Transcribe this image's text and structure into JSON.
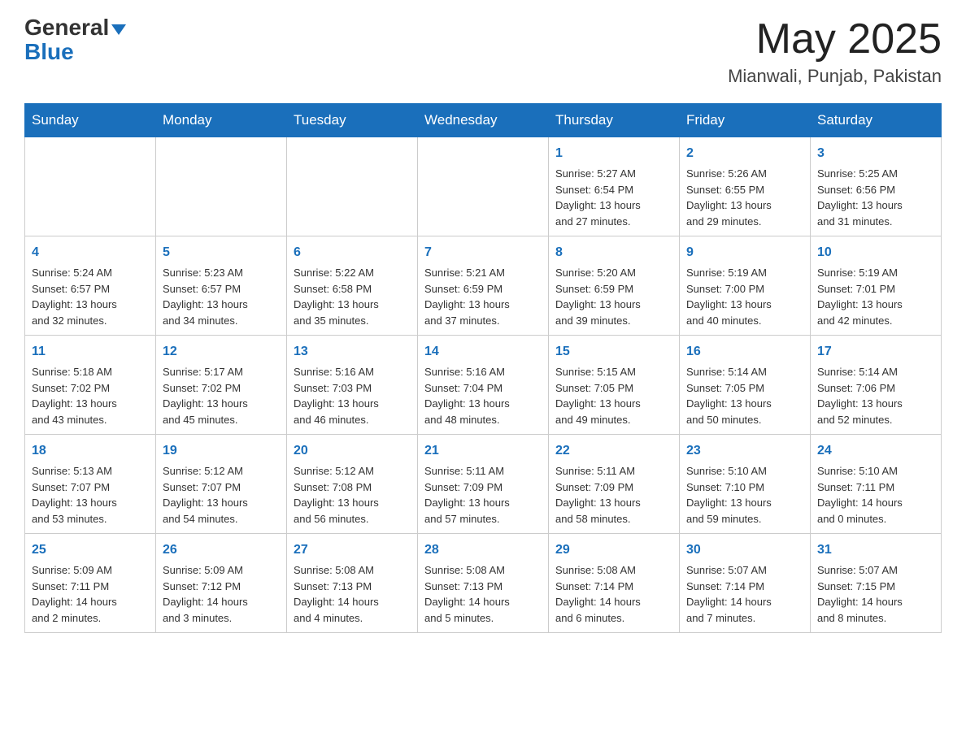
{
  "header": {
    "logo_general": "General",
    "logo_blue": "Blue",
    "month_title": "May 2025",
    "location": "Mianwali, Punjab, Pakistan"
  },
  "weekdays": [
    "Sunday",
    "Monday",
    "Tuesday",
    "Wednesday",
    "Thursday",
    "Friday",
    "Saturday"
  ],
  "weeks": [
    {
      "days": [
        {
          "number": "",
          "info": ""
        },
        {
          "number": "",
          "info": ""
        },
        {
          "number": "",
          "info": ""
        },
        {
          "number": "",
          "info": ""
        },
        {
          "number": "1",
          "info": "Sunrise: 5:27 AM\nSunset: 6:54 PM\nDaylight: 13 hours\nand 27 minutes."
        },
        {
          "number": "2",
          "info": "Sunrise: 5:26 AM\nSunset: 6:55 PM\nDaylight: 13 hours\nand 29 minutes."
        },
        {
          "number": "3",
          "info": "Sunrise: 5:25 AM\nSunset: 6:56 PM\nDaylight: 13 hours\nand 31 minutes."
        }
      ]
    },
    {
      "days": [
        {
          "number": "4",
          "info": "Sunrise: 5:24 AM\nSunset: 6:57 PM\nDaylight: 13 hours\nand 32 minutes."
        },
        {
          "number": "5",
          "info": "Sunrise: 5:23 AM\nSunset: 6:57 PM\nDaylight: 13 hours\nand 34 minutes."
        },
        {
          "number": "6",
          "info": "Sunrise: 5:22 AM\nSunset: 6:58 PM\nDaylight: 13 hours\nand 35 minutes."
        },
        {
          "number": "7",
          "info": "Sunrise: 5:21 AM\nSunset: 6:59 PM\nDaylight: 13 hours\nand 37 minutes."
        },
        {
          "number": "8",
          "info": "Sunrise: 5:20 AM\nSunset: 6:59 PM\nDaylight: 13 hours\nand 39 minutes."
        },
        {
          "number": "9",
          "info": "Sunrise: 5:19 AM\nSunset: 7:00 PM\nDaylight: 13 hours\nand 40 minutes."
        },
        {
          "number": "10",
          "info": "Sunrise: 5:19 AM\nSunset: 7:01 PM\nDaylight: 13 hours\nand 42 minutes."
        }
      ]
    },
    {
      "days": [
        {
          "number": "11",
          "info": "Sunrise: 5:18 AM\nSunset: 7:02 PM\nDaylight: 13 hours\nand 43 minutes."
        },
        {
          "number": "12",
          "info": "Sunrise: 5:17 AM\nSunset: 7:02 PM\nDaylight: 13 hours\nand 45 minutes."
        },
        {
          "number": "13",
          "info": "Sunrise: 5:16 AM\nSunset: 7:03 PM\nDaylight: 13 hours\nand 46 minutes."
        },
        {
          "number": "14",
          "info": "Sunrise: 5:16 AM\nSunset: 7:04 PM\nDaylight: 13 hours\nand 48 minutes."
        },
        {
          "number": "15",
          "info": "Sunrise: 5:15 AM\nSunset: 7:05 PM\nDaylight: 13 hours\nand 49 minutes."
        },
        {
          "number": "16",
          "info": "Sunrise: 5:14 AM\nSunset: 7:05 PM\nDaylight: 13 hours\nand 50 minutes."
        },
        {
          "number": "17",
          "info": "Sunrise: 5:14 AM\nSunset: 7:06 PM\nDaylight: 13 hours\nand 52 minutes."
        }
      ]
    },
    {
      "days": [
        {
          "number": "18",
          "info": "Sunrise: 5:13 AM\nSunset: 7:07 PM\nDaylight: 13 hours\nand 53 minutes."
        },
        {
          "number": "19",
          "info": "Sunrise: 5:12 AM\nSunset: 7:07 PM\nDaylight: 13 hours\nand 54 minutes."
        },
        {
          "number": "20",
          "info": "Sunrise: 5:12 AM\nSunset: 7:08 PM\nDaylight: 13 hours\nand 56 minutes."
        },
        {
          "number": "21",
          "info": "Sunrise: 5:11 AM\nSunset: 7:09 PM\nDaylight: 13 hours\nand 57 minutes."
        },
        {
          "number": "22",
          "info": "Sunrise: 5:11 AM\nSunset: 7:09 PM\nDaylight: 13 hours\nand 58 minutes."
        },
        {
          "number": "23",
          "info": "Sunrise: 5:10 AM\nSunset: 7:10 PM\nDaylight: 13 hours\nand 59 minutes."
        },
        {
          "number": "24",
          "info": "Sunrise: 5:10 AM\nSunset: 7:11 PM\nDaylight: 14 hours\nand 0 minutes."
        }
      ]
    },
    {
      "days": [
        {
          "number": "25",
          "info": "Sunrise: 5:09 AM\nSunset: 7:11 PM\nDaylight: 14 hours\nand 2 minutes."
        },
        {
          "number": "26",
          "info": "Sunrise: 5:09 AM\nSunset: 7:12 PM\nDaylight: 14 hours\nand 3 minutes."
        },
        {
          "number": "27",
          "info": "Sunrise: 5:08 AM\nSunset: 7:13 PM\nDaylight: 14 hours\nand 4 minutes."
        },
        {
          "number": "28",
          "info": "Sunrise: 5:08 AM\nSunset: 7:13 PM\nDaylight: 14 hours\nand 5 minutes."
        },
        {
          "number": "29",
          "info": "Sunrise: 5:08 AM\nSunset: 7:14 PM\nDaylight: 14 hours\nand 6 minutes."
        },
        {
          "number": "30",
          "info": "Sunrise: 5:07 AM\nSunset: 7:14 PM\nDaylight: 14 hours\nand 7 minutes."
        },
        {
          "number": "31",
          "info": "Sunrise: 5:07 AM\nSunset: 7:15 PM\nDaylight: 14 hours\nand 8 minutes."
        }
      ]
    }
  ]
}
